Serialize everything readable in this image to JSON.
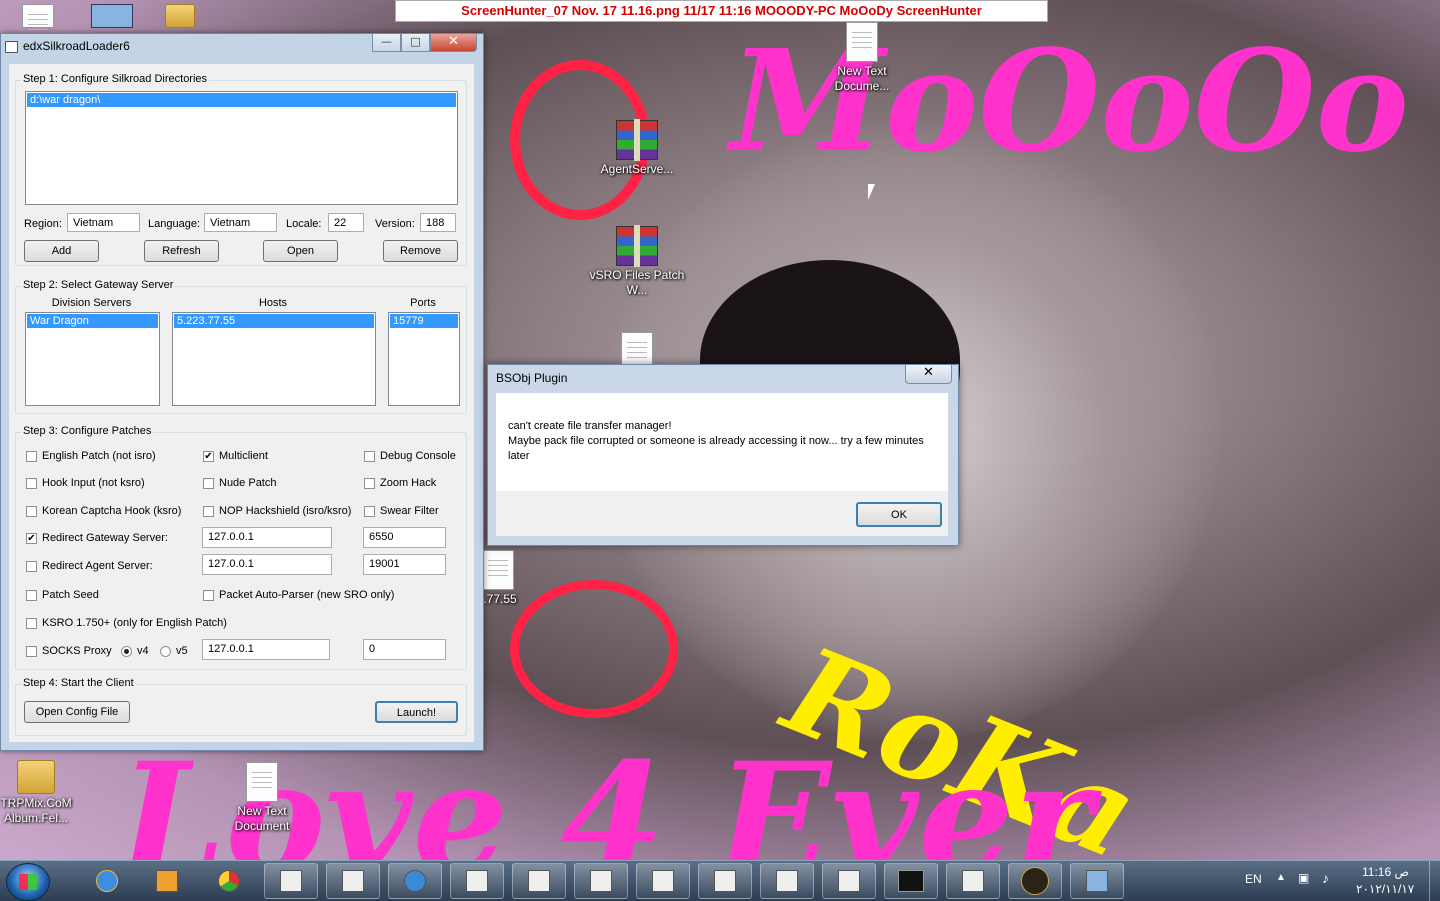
{
  "screenhunter_bar": "ScreenHunter_07 Nov. 17 11.16.png  11/17  11:16  MOOODY-PC  MoOoDy  ScreenHunter",
  "wallpaper": {
    "text_top": "MoOoOo",
    "text_right": "RoKa",
    "text_bottom": "Love 4 Ever"
  },
  "desktop_icons": {
    "new_text_doc_top": "New Text Docume...",
    "agentserver": "AgentServe...",
    "vsro_files": "vSRO Files Patch W...",
    "partial_ip": ".77.55",
    "trpmix": "TRPMix.CoM Album.Fel...",
    "new_text_doc_bottom": "New Text Document"
  },
  "window": {
    "title": "edxSilkroadLoader6",
    "step1": {
      "legend": "Step 1: Configure Silkroad Directories",
      "directory": "d:\\war dragon\\",
      "region_label": "Region:",
      "region_value": "Vietnam",
      "language_label": "Language:",
      "language_value": "Vietnam",
      "locale_label": "Locale:",
      "locale_value": "22",
      "version_label": "Version:",
      "version_value": "188",
      "add": "Add",
      "refresh": "Refresh",
      "open": "Open",
      "remove": "Remove"
    },
    "step2": {
      "legend": "Step 2: Select Gateway Server",
      "col_division": "Division Servers",
      "col_hosts": "Hosts",
      "col_ports": "Ports",
      "division": "War Dragon",
      "host": "5.223.77.55",
      "port": "15779"
    },
    "step3": {
      "legend": "Step 3: Configure Patches",
      "english_patch": "English Patch (not isro)",
      "multiclient": "Multiclient",
      "debug_console": "Debug Console",
      "hook_input": "Hook Input (not ksro)",
      "nude_patch": "Nude Patch",
      "zoom_hack": "Zoom Hack",
      "korean_captcha": "Korean Captcha Hook (ksro)",
      "nop_hackshield": "NOP Hackshield (isro/ksro)",
      "swear_filter": "Swear Filter",
      "redirect_gateway": "Redirect Gateway Server:",
      "gateway_ip": "127.0.0.1",
      "gateway_port": "6550",
      "redirect_agent": "Redirect Agent Server:",
      "agent_ip": "127.0.0.1",
      "agent_port": "19001",
      "patch_seed": "Patch Seed",
      "packet_parser": "Packet Auto-Parser (new SRO only)",
      "ksro": "KSRO 1.750+ (only for English Patch)",
      "socks_proxy": "SOCKS Proxy",
      "v4": "v4",
      "v5": "v5",
      "socks_ip": "127.0.0.1",
      "socks_port": "0"
    },
    "step4": {
      "legend": "Step 4: Start the Client",
      "open_config": "Open Config File",
      "launch": "Launch!"
    }
  },
  "dialog": {
    "title": "BSObj Plugin",
    "line1": "can't create file transfer manager!",
    "line2": "Maybe pack file corrupted or someone is already accessing it now... try a few minutes later",
    "ok": "OK"
  },
  "tray": {
    "language": "EN",
    "time": "11:16 ص",
    "date": "٢٠١٢/١١/١٧"
  },
  "colors": {
    "selection": "#3399ff",
    "hunter_text": "#d40000",
    "wallpaper_pink": "#ff33cc",
    "wallpaper_yellow": "#ffee00",
    "heart_red": "#ff2244"
  }
}
